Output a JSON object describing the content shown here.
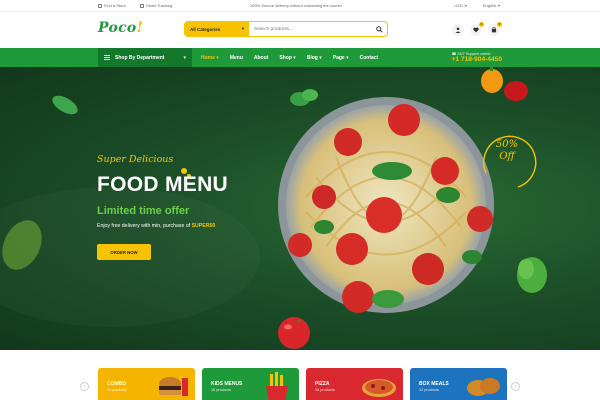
{
  "topbar": {
    "find_store": "Find a Store",
    "order_tracking": "Order Tracking",
    "promo": "100% Secure delivery without contacting the courier",
    "currency": "USD",
    "language": "English"
  },
  "header": {
    "logo_text": "Poco",
    "logo_mark": "!",
    "category_select": "All Categories",
    "search_placeholder": "Search products...",
    "cart_count": "0",
    "wishlist_count": "0"
  },
  "nav": {
    "department": "Shop By Department",
    "items": [
      {
        "label": "Home",
        "active": true
      },
      {
        "label": "Menu"
      },
      {
        "label": "About"
      },
      {
        "label": "Shop"
      },
      {
        "label": "Blog"
      },
      {
        "label": "Page"
      },
      {
        "label": "Contact"
      }
    ],
    "support_label": "24/7 Support center",
    "support_phone": "+1 718-904-4450"
  },
  "hero": {
    "eyebrow": "Super Delicious",
    "title": "FOOD MENU",
    "subtitle": "Limited time offer",
    "desc_prefix": "Enjoy free delivery with min, purchase of",
    "promo_code": "SUPER50",
    "cta": "ORDER NOW",
    "discount_line1": "50%",
    "discount_line2": "Off"
  },
  "categories": [
    {
      "title": "COMBO",
      "count": "11 products",
      "color": "#f5b400"
    },
    {
      "title": "KIDS MENUS",
      "count": "16 products",
      "color": "#1f9a3a"
    },
    {
      "title": "PIZZA",
      "count": "18 products",
      "color": "#d9282f"
    },
    {
      "title": "BOX MEALS",
      "count": "12 products",
      "color": "#1e73be"
    }
  ],
  "colors": {
    "brand_green": "#1f9a3a",
    "accent_yellow": "#f7c300"
  }
}
